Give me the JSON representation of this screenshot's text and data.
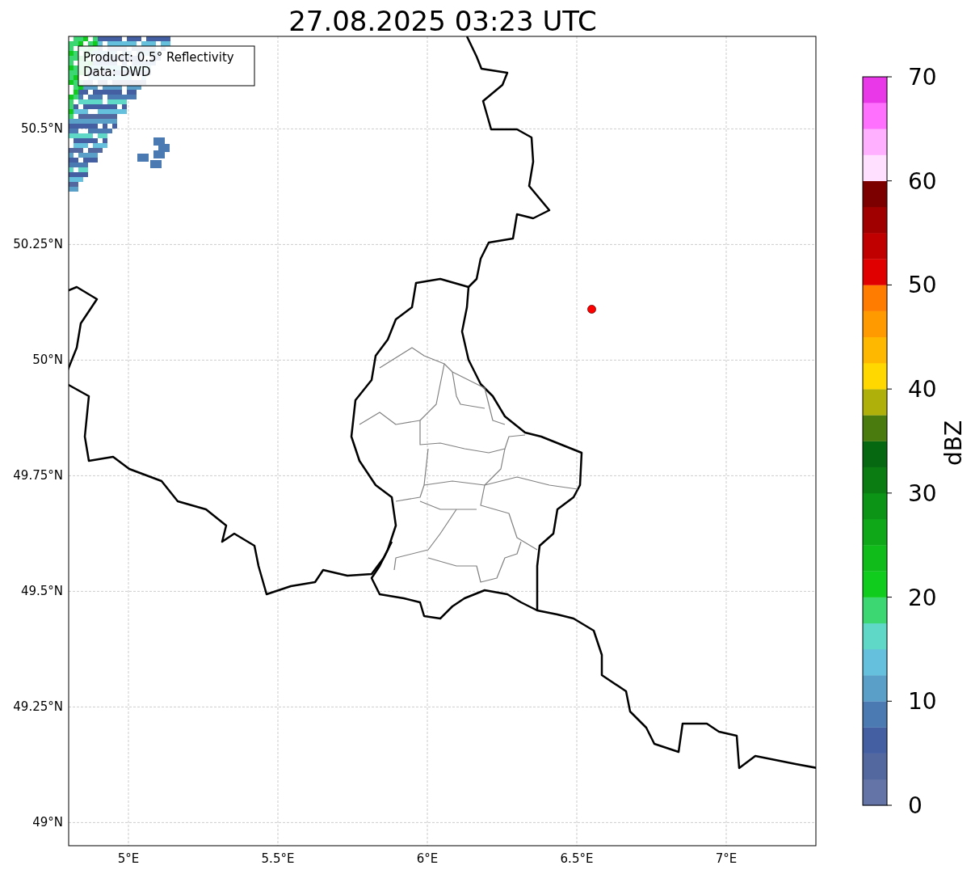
{
  "title": "27.08.2025 03:23 UTC",
  "info_box": {
    "lines": [
      "Product: 0.5° Reflectivity",
      "Data: DWD"
    ]
  },
  "map": {
    "chart_data": {
      "type": "scatter",
      "xlim": [
        4.8,
        7.3
      ],
      "ylim": [
        48.95,
        50.7
      ],
      "xticks": [
        {
          "value": 5,
          "label": "5°E"
        },
        {
          "value": 5.5,
          "label": "5.5°E"
        },
        {
          "value": 6,
          "label": "6°E"
        },
        {
          "value": 6.5,
          "label": "6.5°E"
        },
        {
          "value": 7,
          "label": "7°E"
        }
      ],
      "yticks": [
        {
          "value": 49,
          "label": "49°N"
        },
        {
          "value": 49.25,
          "label": "49.25°N"
        },
        {
          "value": 49.5,
          "label": "49.5°N"
        },
        {
          "value": 49.75,
          "label": "49.75°N"
        },
        {
          "value": 50,
          "label": "50°N"
        },
        {
          "value": 50.25,
          "label": "50.25°N"
        },
        {
          "value": 50.5,
          "label": "50.5°N"
        }
      ],
      "x": [
        6.55
      ],
      "grid": true,
      "series": [
        {
          "color": "#ff0000",
          "values": [
            50.11
          ]
        }
      ]
    }
  },
  "colorbar": {
    "label": "dBZ",
    "tick_labels": [
      "70",
      "60",
      "50",
      "40",
      "30",
      "20",
      "10",
      "0"
    ],
    "bins": [
      {
        "color": "#6474a6"
      },
      {
        "color": "#5468a0"
      },
      {
        "color": "#4460a3"
      },
      {
        "color": "#4b7ab3"
      },
      {
        "color": "#5a9fc8"
      },
      {
        "color": "#64c0dc"
      },
      {
        "color": "#5fd8c8"
      },
      {
        "color": "#3cd672"
      },
      {
        "color": "#10cc1c"
      },
      {
        "color": "#10bc1a"
      },
      {
        "color": "#0ea818"
      },
      {
        "color": "#0c9417"
      },
      {
        "color": "#0a7c12"
      },
      {
        "color": "#066810"
      },
      {
        "color": "#4a7b0e"
      },
      {
        "color": "#b0b00a"
      },
      {
        "color": "#ffd800"
      },
      {
        "color": "#ffb800"
      },
      {
        "color": "#ff9a00"
      },
      {
        "color": "#ff7c00"
      },
      {
        "color": "#e00000"
      },
      {
        "color": "#c00000"
      },
      {
        "color": "#a00000"
      },
      {
        "color": "#7d0000"
      },
      {
        "color": "#ffe0ff"
      },
      {
        "color": "#ffb0ff"
      },
      {
        "color": "#ff70ff"
      },
      {
        "color": "#e838e8"
      }
    ]
  }
}
